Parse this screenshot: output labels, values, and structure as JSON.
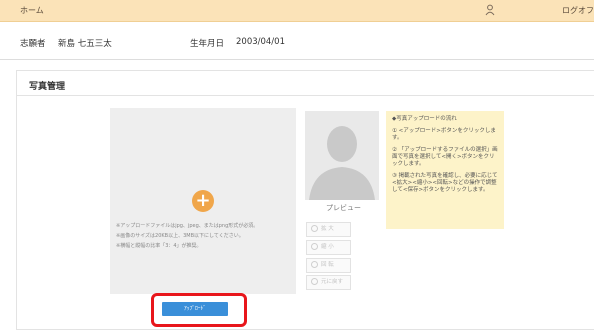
{
  "header": {
    "home_label": "ホーム",
    "logout_label": "ログオフ"
  },
  "applicant": {
    "name_label": "志願者",
    "name_value": "新島 七五三太",
    "dob_label": "生年月日",
    "dob_value": "2003/04/01"
  },
  "section": {
    "title": "写真管理"
  },
  "upload": {
    "notes": [
      "※アップロードファイルはjpg、jpeg、またはpng形式が必須。",
      "※画像のサイズは20KB以上、3MB以下にしてください。",
      "※横幅と縦幅の比率「3：4」が推奨。"
    ],
    "button_label": "ｱｯﾌﾟﾛｰﾄﾞ"
  },
  "preview": {
    "label": "プレビュー",
    "tools": [
      "拡 大",
      "縮 小",
      "回 転",
      "元に戻す"
    ]
  },
  "instructions": {
    "title": "◆写真アップロードの流れ",
    "steps": [
      "① <アップロード>ボタンをクリックします。",
      "② 「アップロードするファイルの選択」画面で写真を選択して<開く>ボタンをクリックします。",
      "③ 掲載された写真を確認し、必要に応じて<拡大><縮小><回転>などの操作で調整して<保存>ボタンをクリックします。"
    ]
  },
  "colors": {
    "header_bg": "#fbe3b8",
    "plus_button": "#f0a64a",
    "upload_button": "#3a8fd9",
    "highlight": "#e8161b",
    "instruction_bg": "#fdf3c9"
  }
}
